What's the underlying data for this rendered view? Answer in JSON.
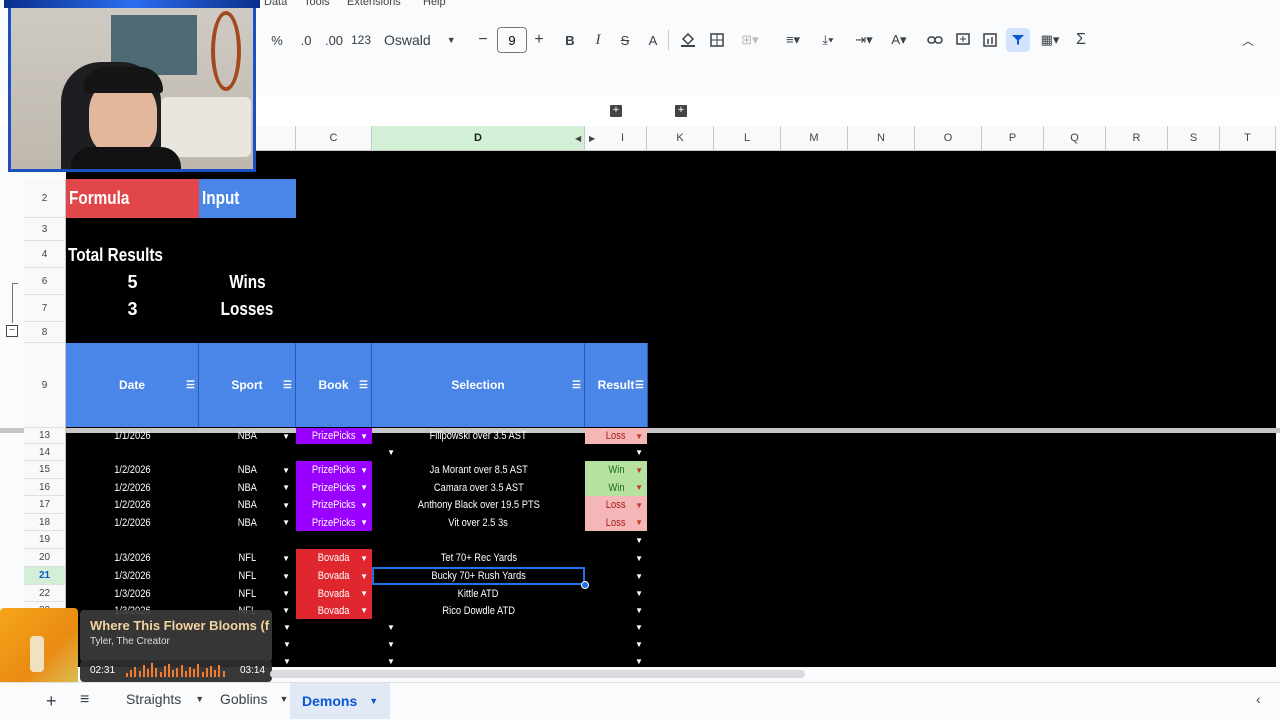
{
  "menu": [
    "Data",
    "Tools",
    "Extensions",
    "Help"
  ],
  "toolbar": {
    "percent": "%",
    "dec_decrease": ".0",
    "dec_increase": ".00",
    "number_format": "123",
    "font": "Oswald",
    "font_size": "9",
    "minus": "−",
    "plus": "+",
    "bold": "B",
    "italic": "I",
    "strike": "S",
    "text_color": "A",
    "sum": "Σ"
  },
  "columns": [
    "C",
    "D",
    "I",
    "K",
    "L",
    "M",
    "N",
    "O",
    "P",
    "Q",
    "R",
    "S",
    "T"
  ],
  "rows": {
    "top": [
      "2",
      "3",
      "4",
      "6",
      "7",
      "8",
      "9"
    ],
    "bottom": [
      "13",
      "14",
      "15",
      "16",
      "17",
      "18",
      "19",
      "20",
      "21",
      "22",
      "23"
    ]
  },
  "labels": {
    "formula": "Formula",
    "input": "Input",
    "total_results": "Total Results",
    "wins_count": "5",
    "wins_label": "Wins",
    "losses_count": "3",
    "losses_label": "Losses"
  },
  "table_headers": [
    "Date",
    "Sport",
    "Book",
    "Selection",
    "Result"
  ],
  "bets": [
    {
      "row": "13",
      "date": "1/1/2026",
      "sport": "NBA",
      "book": "PrizePicks",
      "selection": "Filipowski over 3.5 AST",
      "result": "Loss"
    },
    {
      "row": "14",
      "date": "",
      "sport": "",
      "book": "",
      "selection": "",
      "result": ""
    },
    {
      "row": "15",
      "date": "1/2/2026",
      "sport": "NBA",
      "book": "PrizePicks",
      "selection": "Ja Morant over 8.5 AST",
      "result": "Win"
    },
    {
      "row": "16",
      "date": "1/2/2026",
      "sport": "NBA",
      "book": "PrizePicks",
      "selection": "Camara over 3.5 AST",
      "result": "Win"
    },
    {
      "row": "17",
      "date": "1/2/2026",
      "sport": "NBA",
      "book": "PrizePicks",
      "selection": "Anthony Black over 19.5 PTS",
      "result": "Loss"
    },
    {
      "row": "18",
      "date": "1/2/2026",
      "sport": "NBA",
      "book": "PrizePicks",
      "selection": "Vit over 2.5 3s",
      "result": "Loss"
    },
    {
      "row": "19",
      "date": "",
      "sport": "",
      "book": "",
      "selection": "",
      "result": ""
    },
    {
      "row": "20",
      "date": "1/3/2026",
      "sport": "NFL",
      "book": "Bovada",
      "selection": "Tet 70+ Rec Yards",
      "result": ""
    },
    {
      "row": "21",
      "date": "1/3/2026",
      "sport": "NFL",
      "book": "Bovada",
      "selection": "Bucky 70+ Rush Yards",
      "result": ""
    },
    {
      "row": "22",
      "date": "1/3/2026",
      "sport": "NFL",
      "book": "Bovada",
      "selection": "Kittle ATD",
      "result": ""
    },
    {
      "row": "23",
      "date": "1/3/2026",
      "sport": "NFL",
      "book": "Bovada",
      "selection": "Rico Dowdle ATD",
      "result": ""
    }
  ],
  "music": {
    "title": "Where This Flower Blooms (f",
    "artist": "Tyler, The Creator",
    "elapsed": "02:31",
    "total": "03:14",
    "progress": 0.78
  },
  "sheet_tabs": [
    "Straights",
    "Goblins",
    "Demons"
  ],
  "active_tab": "Demons",
  "colors": {
    "formula": "#e0464a",
    "input": "#4a86e8",
    "header": "#4a86e8",
    "prizepicks": "#9900ff",
    "bovada": "#e0262e",
    "win": "#b7e1a1",
    "loss": "#f4b6b6",
    "selected_col": "#d3f0d6"
  }
}
